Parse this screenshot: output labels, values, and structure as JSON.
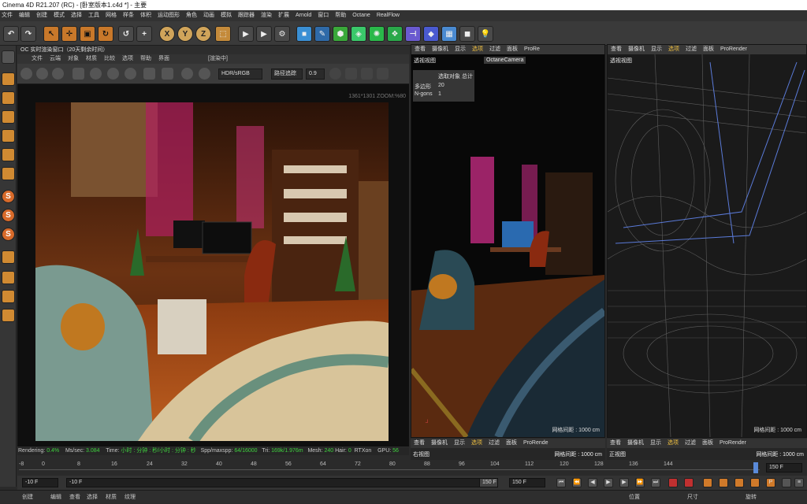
{
  "window": {
    "title": "Cinema 4D R21.207 (RC) - [卧室版本1.c4d *] - 主要"
  },
  "menubar": [
    "文件",
    "编辑",
    "创建",
    "模式",
    "选择",
    "工具",
    "网格",
    "样条",
    "体积",
    "运动图形",
    "角色",
    "动画",
    "模拟",
    "跟踪器",
    "渲染",
    "扩展",
    "Arnold",
    "窗口",
    "帮助",
    "Octane",
    "RealFlow"
  ],
  "toolbar": {
    "axis_x": "X",
    "axis_y": "Y",
    "axis_z": "Z"
  },
  "octane": {
    "header": "OC 实时渲染窗口（20天剩余时间）",
    "menu": [
      "文件",
      "云端",
      "对象",
      "材质",
      "比较",
      "选项",
      "帮助",
      "界面"
    ],
    "status_chip": "[渲染中]",
    "color_space": "HDR/sRGB",
    "kernel": "路径追踪",
    "exposure": "0.9",
    "render_info": "1361*1301 ZOOM:%80",
    "status": {
      "rendering_label": "Rendering:",
      "rendering_value": "0.4%",
      "ms_label": "Ms/sec:",
      "ms_value": "3.084",
      "time_label": "Time:",
      "time_value": "小时 : 分钟 : 秒/小时 : 分钟 : 秒",
      "spp_label": "Spp/maxspp:",
      "spp_value": "64/16000",
      "tri_label": "Tri:",
      "tri_value": "169k/1.976m",
      "mesh_label": "Mesh:",
      "mesh_value": "240",
      "hair_label": "Hair:",
      "hair_value": "0",
      "rtx_label": "RTXon",
      "gpu_label": "GPU:",
      "gpu_value": "56"
    }
  },
  "mid_viewport": {
    "menu": [
      "查看",
      "摄像机",
      "显示",
      "选项",
      "过滤",
      "面板",
      "ProRe"
    ],
    "name": "透视视图",
    "camera": "OctaneCamera",
    "stats_header": "选取对象 总计",
    "stats": [
      {
        "label": "多边形",
        "value": "20"
      },
      {
        "label": "N-gons",
        "value": "1"
      }
    ],
    "grid": "网格间距 : 1000 cm"
  },
  "right_viewport": {
    "menu": [
      "查看",
      "摄像机",
      "显示",
      "选项",
      "过滤",
      "面板",
      "ProRender"
    ],
    "name": "透视视图",
    "grid": "网格间距 : 1000 cm"
  },
  "bottom_left_vp": {
    "menu": [
      "查看",
      "摄像机",
      "显示",
      "选项",
      "过滤",
      "面板",
      "ProRende"
    ],
    "name": "右视图",
    "grid": "网格间距 : 1000 cm"
  },
  "bottom_right_vp": {
    "menu": [
      "查看",
      "摄像机",
      "显示",
      "选项",
      "过滤",
      "面板",
      "ProRender"
    ],
    "name": "正视图",
    "grid": "网格间距 : 1000 cm"
  },
  "timeline": {
    "ticks": [
      "-8",
      "0",
      "8",
      "16",
      "24",
      "32",
      "40",
      "48",
      "56",
      "64",
      "72",
      "80",
      "88",
      "96",
      "104",
      "112",
      "120",
      "128",
      "136",
      "144"
    ],
    "current_frame": "150 F"
  },
  "transport": {
    "start": "-10 F",
    "start2": "-10 F",
    "end": "150 F",
    "end2": "150 F"
  },
  "bottombar": {
    "left": [
      "创建",
      "编辑",
      "查看",
      "选择",
      "材质",
      "纹理"
    ],
    "right": [
      "位置",
      "尺寸",
      "旋转"
    ]
  }
}
